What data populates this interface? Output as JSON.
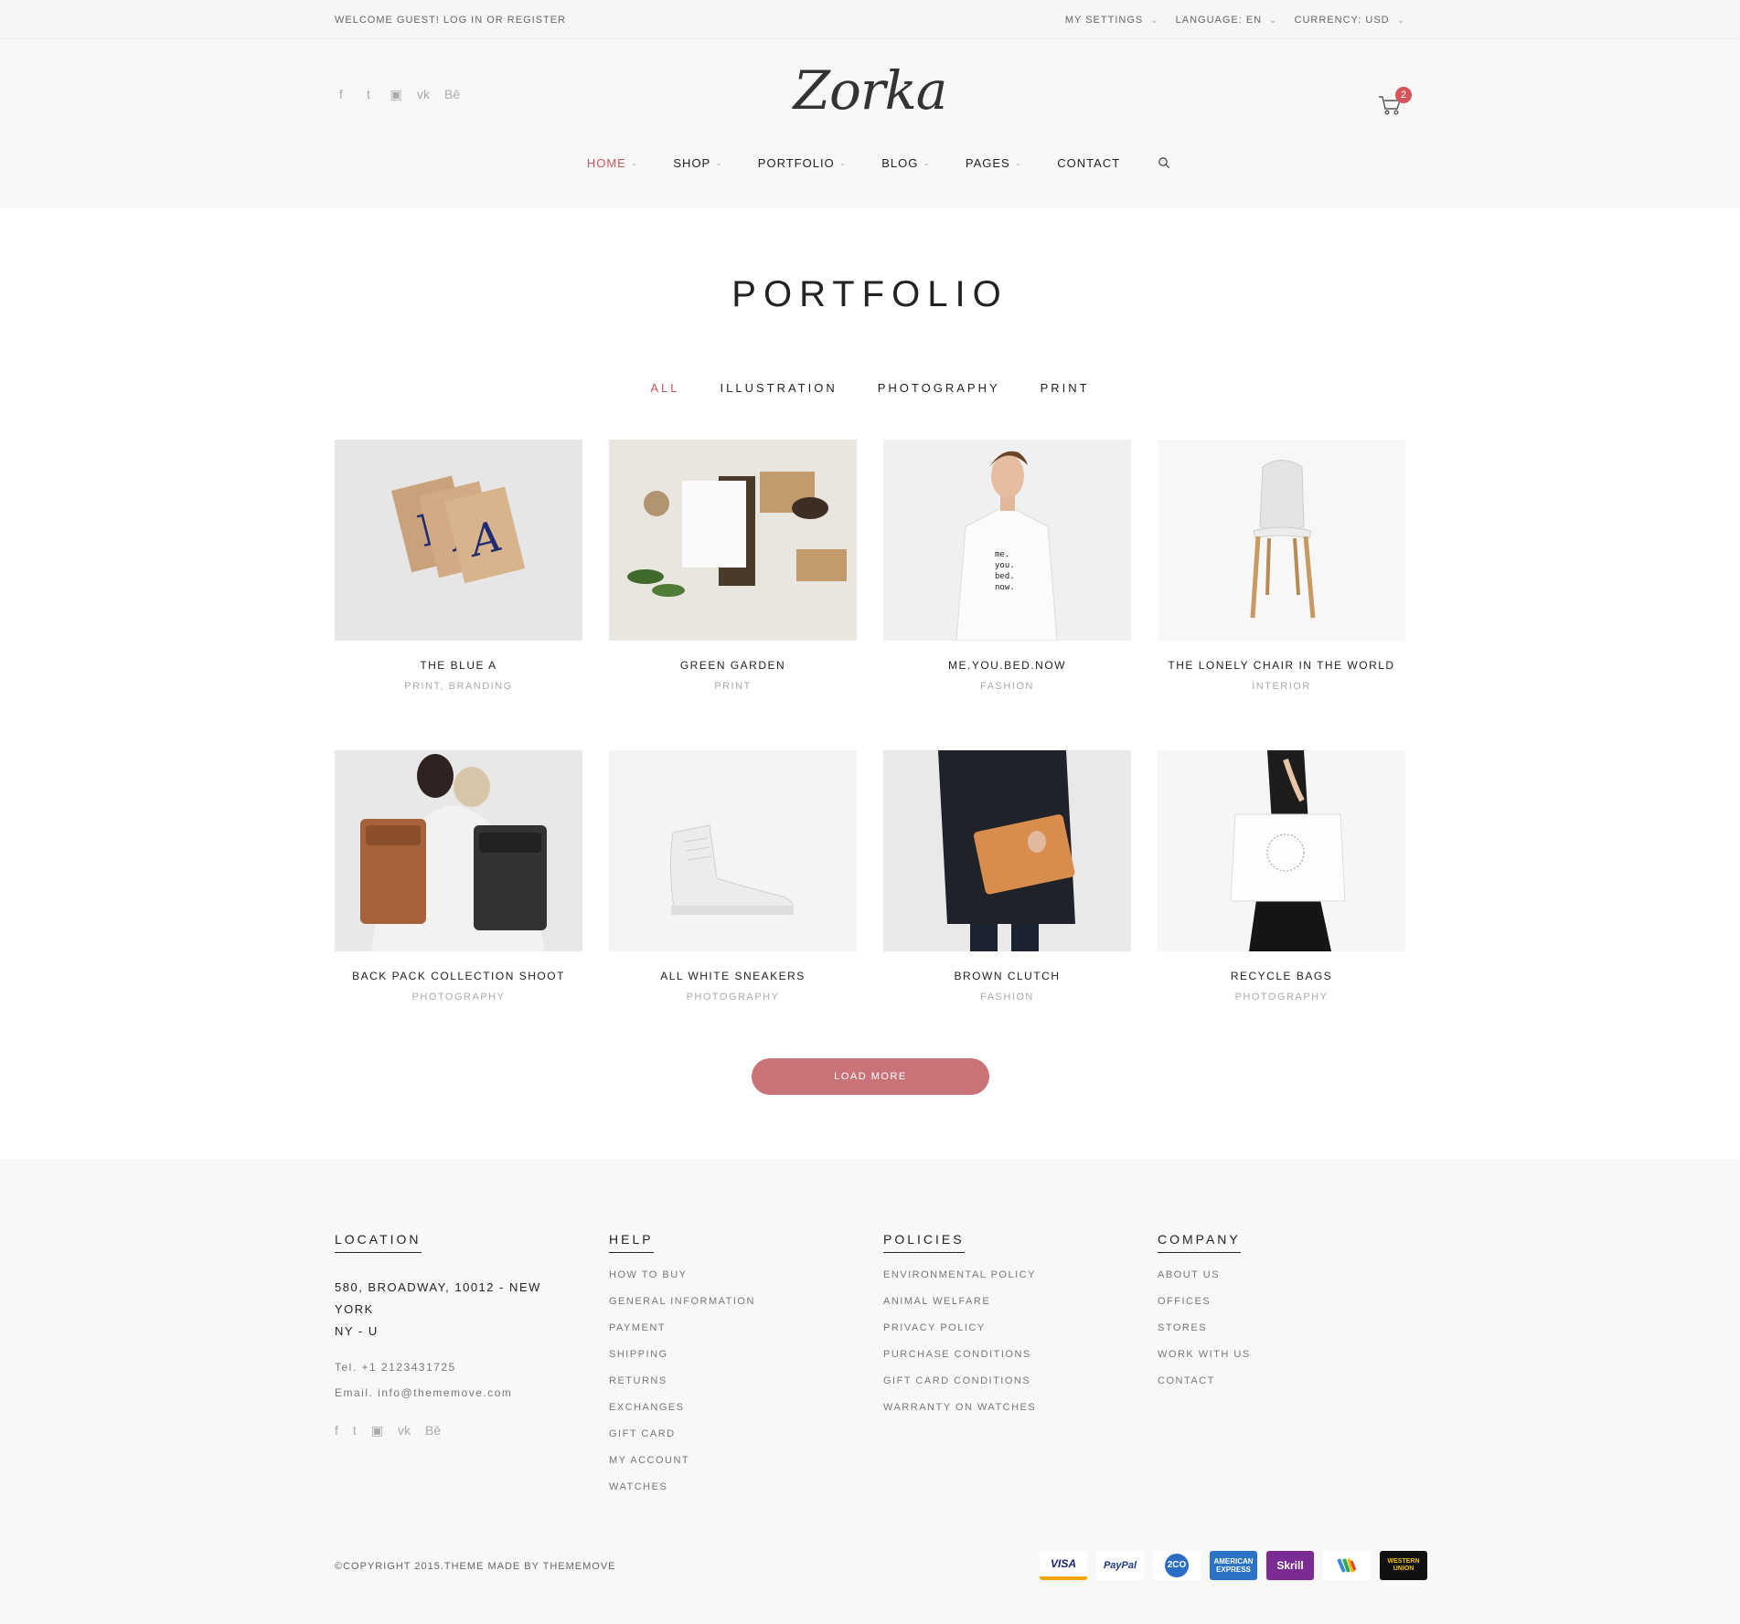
{
  "topbar": {
    "welcome": "WELCOME GUEST! LOG IN OR REGISTER",
    "settings": [
      {
        "label": "MY SETTINGS"
      },
      {
        "label": "LANGUAGE: EN"
      },
      {
        "label": "CURRENCY: USD"
      }
    ]
  },
  "header": {
    "logo": "Zorka",
    "cart_count": "2",
    "socials": [
      "facebook-icon",
      "twitter-icon",
      "instagram-icon",
      "vk-icon",
      "behance-icon"
    ]
  },
  "nav": [
    {
      "label": "HOME",
      "dropdown": true,
      "active": true
    },
    {
      "label": "SHOP",
      "dropdown": true
    },
    {
      "label": "PORTFOLIO",
      "dropdown": true
    },
    {
      "label": "BLOG",
      "dropdown": true
    },
    {
      "label": "PAGES",
      "dropdown": true
    },
    {
      "label": "CONTACT",
      "dropdown": false
    }
  ],
  "main": {
    "title": "PORTFOLIO",
    "filters": [
      {
        "label": "ALL",
        "active": true
      },
      {
        "label": "ILLUSTRATION"
      },
      {
        "label": "PHOTOGRAPHY"
      },
      {
        "label": "PRINT"
      }
    ],
    "items": [
      {
        "title": "THE BLUE A",
        "category": "PRINT, BRANDING"
      },
      {
        "title": "GREEN GARDEN",
        "category": "PRINT"
      },
      {
        "title": "ME.YOU.BED.NOW",
        "category": "FASHION"
      },
      {
        "title": "THE LONELY CHAIR IN THE WORLD",
        "category": "INTERIOR"
      },
      {
        "title": "BACK PACK COLLECTION SHOOT",
        "category": "PHOTOGRAPHY"
      },
      {
        "title": "ALL WHITE SNEAKERS",
        "category": "PHOTOGRAPHY"
      },
      {
        "title": "BROWN CLUTCH",
        "category": "FASHION"
      },
      {
        "title": "RECYCLE BAGS",
        "category": "PHOTOGRAPHY"
      }
    ],
    "load_more": "LOAD MORE"
  },
  "footer": {
    "location": {
      "heading": "LOCATION",
      "address_line1": "580, BROADWAY, 10012 - NEW YORK",
      "address_line2": "NY - U",
      "tel": "Tel. +1 2123431725",
      "email": "Email. info@thememove.com"
    },
    "help": {
      "heading": "HELP",
      "links": [
        "HOW TO BUY",
        "GENERAL INFORMATION",
        "PAYMENT",
        "SHIPPING",
        "RETURNS",
        "EXCHANGES",
        "GIFT CARD",
        "MY ACCOUNT",
        "WATCHES"
      ]
    },
    "policies": {
      "heading": "POLICIES",
      "links": [
        "ENVIRONMENTAL POLICY",
        "ANIMAL WELFARE",
        "PRIVACY POLICY",
        "PURCHASE CONDITIONS",
        "GIFT CARD CONDITIONS",
        "WARRANTY ON WATCHES"
      ]
    },
    "company": {
      "heading": "COMPANY",
      "links": [
        "ABOUT US",
        "OFFICES",
        "STORES",
        "WORK WITH US",
        "CONTACT"
      ]
    },
    "copyright": "©COPYRIGHT 2015.THEME MADE BY THEMEMOVE",
    "payments": [
      "VISA",
      "PayPal",
      "2CO",
      "AMERICAN EXPRESS",
      "Skrill",
      "Google Wallet",
      "WESTERN UNION"
    ]
  },
  "colors": {
    "accent": "#c9555c",
    "button": "#c97278"
  }
}
